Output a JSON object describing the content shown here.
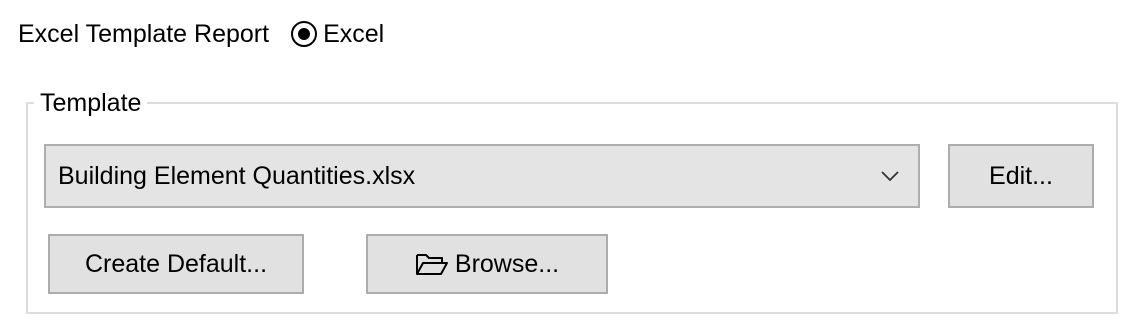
{
  "report": {
    "label": "Excel Template Report",
    "radio_label": "Excel",
    "radio_selected": true
  },
  "template_group": {
    "title": "Template",
    "combo_value": "Building Element Quantities.xlsx",
    "edit_label": "Edit...",
    "create_default_label": "Create Default...",
    "browse_label": "Browse..."
  },
  "icons": {
    "dropdown": "chevron-down-icon",
    "browse": "folder-open-icon"
  },
  "colors": {
    "button_bg": "#e1e1e1",
    "button_border": "#adadad",
    "groupbox_border": "#dcdcdc"
  }
}
